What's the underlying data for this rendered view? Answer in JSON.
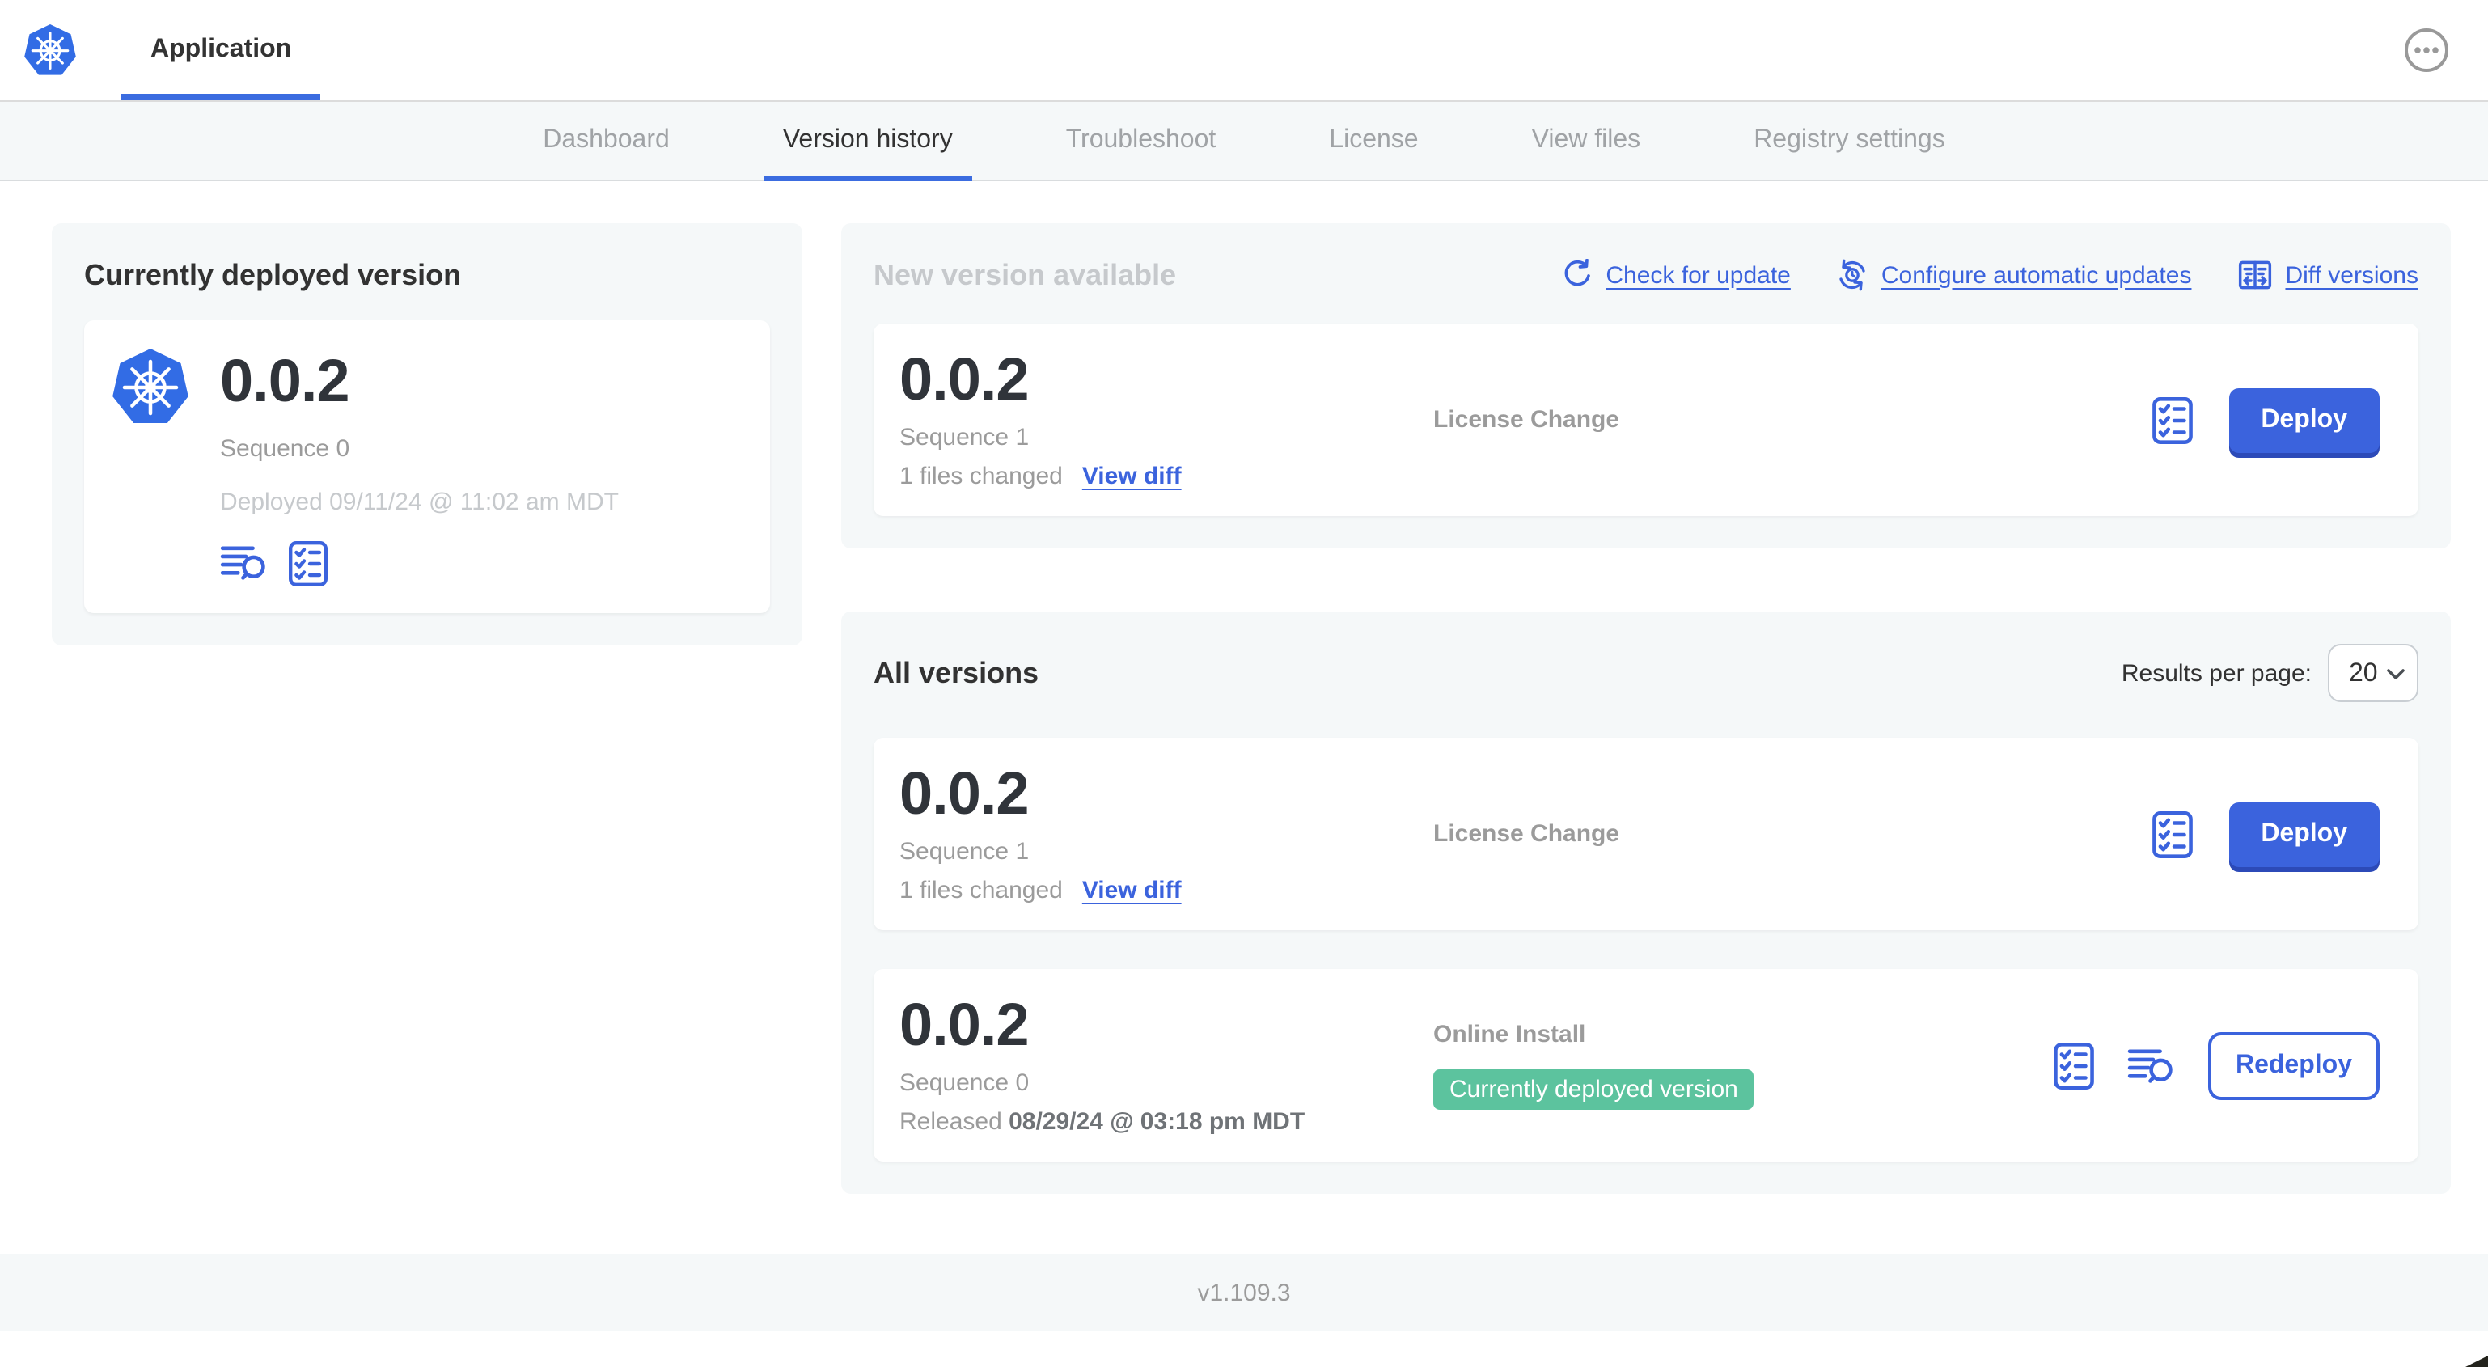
{
  "colors": {
    "accent_blue": "#3b63dd",
    "tab_underline_blue": "#3b6ce0",
    "kubernetes_blue": "#326ce5",
    "badge_green": "#5cc39e",
    "panel_bg": "#f5f8f9",
    "dark_text": "#323232",
    "gray_text": "#9b9b9b",
    "muted_text": "#c6c9cc"
  },
  "header": {
    "app_tab_label": "Application",
    "logo_icon": "kubernetes-logo",
    "more_menu_icon": "ellipsis-icon"
  },
  "nav": {
    "tabs": [
      {
        "label": "Dashboard",
        "active": false
      },
      {
        "label": "Version history",
        "active": true
      },
      {
        "label": "Troubleshoot",
        "active": false
      },
      {
        "label": "License",
        "active": false
      },
      {
        "label": "View files",
        "active": false
      },
      {
        "label": "Registry settings",
        "active": false
      }
    ]
  },
  "deployed_card": {
    "title": "Currently deployed version",
    "version": "0.0.2",
    "sequence": "Sequence 0",
    "deployed_at": "Deployed 09/11/24 @ 11:02 am MDT",
    "icons": [
      "logs-icon",
      "preflight-checks-icon"
    ]
  },
  "new_version": {
    "title": "New version available",
    "links": [
      {
        "label": "Check for update",
        "icon": "refresh-icon"
      },
      {
        "label": "Configure automatic updates",
        "icon": "auto-update-clock-icon"
      },
      {
        "label": "Diff versions",
        "icon": "diff-icon"
      }
    ],
    "row": {
      "version": "0.0.2",
      "sequence": "Sequence 1",
      "files_changed": "1 files changed",
      "view_diff_label": "View diff",
      "release_notes": "License Change",
      "deploy_label": "Deploy",
      "icons": [
        "preflight-checks-icon"
      ]
    }
  },
  "all_versions": {
    "title": "All versions",
    "results_per_page_label": "Results per page:",
    "results_per_page_value": "20",
    "rows": [
      {
        "version": "0.0.2",
        "sequence": "Sequence 1",
        "files_changed": "1 files changed",
        "view_diff_label": "View diff",
        "release_notes": "License Change",
        "action_label": "Deploy",
        "icons": [
          "preflight-checks-icon"
        ]
      },
      {
        "version": "0.0.2",
        "sequence": "Sequence 0",
        "released_label": "Released ",
        "released_date": "08/29/24 @ 03:18 pm MDT",
        "source": "Online Install",
        "badge": "Currently deployed version",
        "action_label": "Redeploy",
        "icons": [
          "preflight-checks-icon",
          "logs-icon"
        ]
      }
    ]
  },
  "footer": {
    "app_version": "v1.109.3"
  }
}
